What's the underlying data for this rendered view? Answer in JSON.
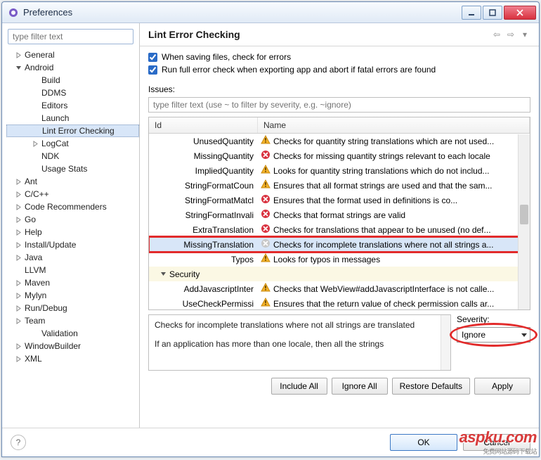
{
  "window": {
    "title": "Preferences"
  },
  "sidebar": {
    "filter_placeholder": "type filter text",
    "items": [
      {
        "label": "General",
        "depth": 1,
        "expand": "closed"
      },
      {
        "label": "Android",
        "depth": 1,
        "expand": "open"
      },
      {
        "label": "Build",
        "depth": 2
      },
      {
        "label": "DDMS",
        "depth": 2
      },
      {
        "label": "Editors",
        "depth": 2
      },
      {
        "label": "Launch",
        "depth": 2
      },
      {
        "label": "Lint Error Checking",
        "depth": 2,
        "selected": true
      },
      {
        "label": "LogCat",
        "depth": 2,
        "expand": "closed"
      },
      {
        "label": "NDK",
        "depth": 2
      },
      {
        "label": "Usage Stats",
        "depth": 2
      },
      {
        "label": "Ant",
        "depth": 1,
        "expand": "closed"
      },
      {
        "label": "C/C++",
        "depth": 1,
        "expand": "closed"
      },
      {
        "label": "Code Recommenders",
        "depth": 1,
        "expand": "closed"
      },
      {
        "label": "Go",
        "depth": 1,
        "expand": "closed"
      },
      {
        "label": "Help",
        "depth": 1,
        "expand": "closed"
      },
      {
        "label": "Install/Update",
        "depth": 1,
        "expand": "closed"
      },
      {
        "label": "Java",
        "depth": 1,
        "expand": "closed"
      },
      {
        "label": "LLVM",
        "depth": 1
      },
      {
        "label": "Maven",
        "depth": 1,
        "expand": "closed"
      },
      {
        "label": "Mylyn",
        "depth": 1,
        "expand": "closed"
      },
      {
        "label": "Run/Debug",
        "depth": 1,
        "expand": "closed"
      },
      {
        "label": "Team",
        "depth": 1,
        "expand": "closed"
      },
      {
        "label": "Validation",
        "depth": 2
      },
      {
        "label": "WindowBuilder",
        "depth": 1,
        "expand": "closed"
      },
      {
        "label": "XML",
        "depth": 1,
        "expand": "closed"
      }
    ]
  },
  "main": {
    "title": "Lint Error Checking",
    "check1": "When saving files, check for errors",
    "check2": "Run full error check when exporting app and abort if fatal errors are found",
    "issues_label": "Issues:",
    "issues_filter_placeholder": "type filter text (use ~ to filter by severity, e.g. ~ignore)",
    "columns": {
      "id": "Id",
      "name": "Name"
    },
    "rows": [
      {
        "id": "UnusedQuantity",
        "icon": "warn",
        "name": "Checks for quantity string translations which are not used..."
      },
      {
        "id": "MissingQuantity",
        "icon": "err",
        "name": "Checks for missing quantity strings relevant to each locale"
      },
      {
        "id": "ImpliedQuantity",
        "icon": "warn",
        "name": "Looks for quantity string translations which do not includ..."
      },
      {
        "id": "StringFormatCoun",
        "icon": "warn",
        "name": "Ensures that all format strings are used and that the sam..."
      },
      {
        "id": "StringFormatMatcl",
        "icon": "err",
        "name": "Ensures that the format used in <string> definitions is co..."
      },
      {
        "id": "StringFormatInvali",
        "icon": "err",
        "name": "Checks that format strings are valid"
      },
      {
        "id": "ExtraTranslation",
        "icon": "err",
        "name": "Checks for translations that appear to be unused (no def..."
      },
      {
        "id": "MissingTranslation",
        "icon": "dis",
        "name": "Checks for incomplete translations where not all strings a...",
        "highlight": true,
        "selected": true
      },
      {
        "id": "Typos",
        "icon": "warn",
        "name": "Looks for typos in messages"
      },
      {
        "cat": "Security"
      },
      {
        "id": "AddJavascriptInter",
        "icon": "warn",
        "name": "Checks that WebView#addJavascriptInterface is not calle..."
      },
      {
        "id": "UseCheckPermissi",
        "icon": "warn",
        "name": "Ensures that the return value of check permission calls ar..."
      }
    ],
    "description": {
      "line1": "Checks for incomplete translations where not all strings are translated",
      "line2": "If an application has more than one locale, then all the strings"
    },
    "severity_label": "Severity:",
    "severity_value": "Ignore",
    "buttons": {
      "include_all": "Include All",
      "ignore_all": "Ignore All",
      "restore": "Restore Defaults",
      "apply": "Apply",
      "ok": "OK",
      "cancel": "Cancel"
    }
  }
}
